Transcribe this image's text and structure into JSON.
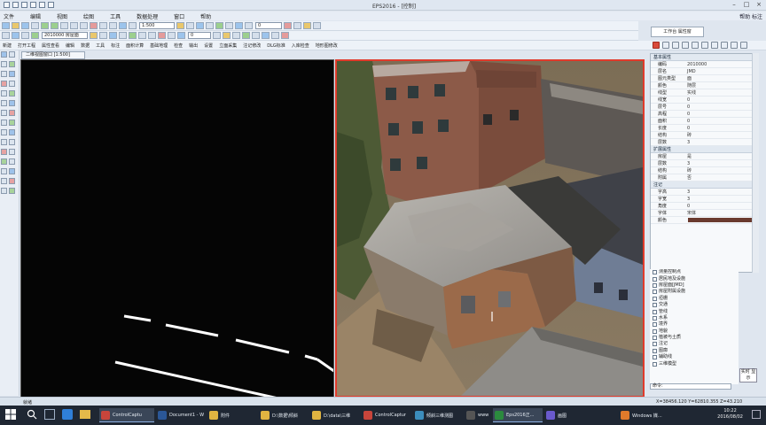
{
  "window": {
    "title": "EPS2016 - [控制]",
    "right_label": "帮助 标注"
  },
  "menu": [
    "文件",
    "编辑",
    "视图",
    "绘图",
    "工具",
    "数据处理",
    "窗口",
    "帮助"
  ],
  "toolbar1": {
    "scale_combo": "1:500",
    "layer_combo": "0"
  },
  "toolbar2": {
    "code_combo": "2010000 房屋面",
    "layer_combo": "0"
  },
  "toolbar3": {
    "items": [
      "新建",
      "打开工程",
      "属性查看",
      "编辑",
      "数据",
      "工具",
      "标注",
      "面积计算",
      "基础地理",
      "检查",
      "输出",
      "设置",
      "立面采集",
      "注记修改",
      "DLG标准",
      "入库检查",
      "地形图修改"
    ]
  },
  "panel": {
    "tab_label": "工作台 属性窗",
    "red_accent": "#e03a2b"
  },
  "left_view": {
    "tab_label": "二维视图窗口 [1:500]"
  },
  "properties": {
    "section_basic": "基本属性",
    "rows": [
      {
        "k": "编码",
        "v": "2010000"
      },
      {
        "k": "层名",
        "v": "JMD"
      },
      {
        "k": "图元类型",
        "v": "面"
      },
      {
        "k": "颜色",
        "v": "随层"
      },
      {
        "k": "线型",
        "v": "实线"
      },
      {
        "k": "线宽",
        "v": "0"
      },
      {
        "k": "层号",
        "v": "0"
      },
      {
        "k": "高程",
        "v": "0"
      },
      {
        "k": "面积",
        "v": "0"
      },
      {
        "k": "长度",
        "v": "0"
      },
      {
        "k": "结构",
        "v": "砖"
      },
      {
        "k": "层数",
        "v": "3"
      }
    ],
    "section_extend": "扩展属性",
    "ext_rows": [
      {
        "k": "房屋",
        "v": "是"
      },
      {
        "k": "层数",
        "v": "3"
      },
      {
        "k": "结构",
        "v": "砖"
      },
      {
        "k": "附属",
        "v": "否"
      }
    ],
    "section_note": "注记",
    "note_rows": [
      {
        "k": "字高",
        "v": "3"
      },
      {
        "k": "字宽",
        "v": "3"
      },
      {
        "k": "角度",
        "v": "0"
      },
      {
        "k": "字体",
        "v": "宋体"
      },
      {
        "k": "颜色",
        "v": ""
      }
    ]
  },
  "tree": {
    "items": [
      "测量控制点",
      "居民地及设施",
      "房屋面[JMD]",
      "房屋附属设施",
      "垣栅",
      "交通",
      "管线",
      "水系",
      "境界",
      "地貌",
      "植被与土质",
      "注记",
      "图廓",
      "辅助线",
      "三维模型"
    ]
  },
  "command": {
    "value": "命令:"
  },
  "side_thumb": "实时\n显示",
  "statusbar": {
    "left": "就绪",
    "coord": "X=38456.120 Y=62810.355 Z=43.210"
  },
  "taskbar": {
    "tasks": [
      {
        "label": "ControlCaptu",
        "color": "#c8453b"
      },
      {
        "label": "Document1 - W",
        "color": "#2b5797"
      },
      {
        "label": "附件",
        "color": "#e0b441"
      },
      {
        "label": "D:\\数据\\倾斜",
        "color": "#e0b441"
      },
      {
        "label": "D:\\data\\三维",
        "color": "#e0b441"
      },
      {
        "label": "ControlCaptur",
        "color": "#c8453b"
      },
      {
        "label": "倾斜三维测图",
        "color": "#3c8dbc"
      },
      {
        "label": "www",
        "color": "#555"
      },
      {
        "label": "Eps2016正...",
        "color": "#2b8a3e"
      },
      {
        "label": "画图",
        "color": "#6a5acd"
      },
      {
        "label": "Windows 媒...",
        "color": "#e07a2b"
      }
    ],
    "clock_time": "10:22",
    "clock_date": "2016/08/02"
  }
}
